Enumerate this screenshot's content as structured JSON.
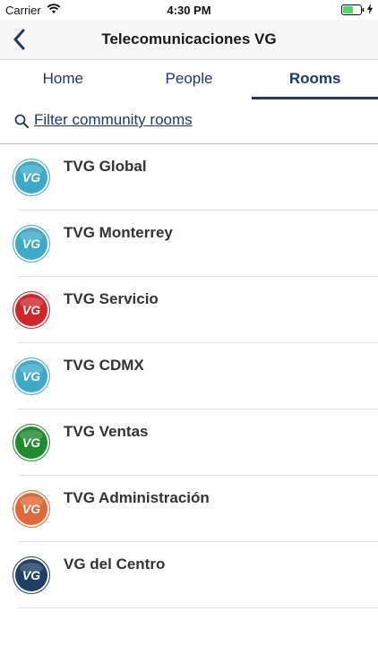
{
  "status_bar": {
    "carrier": "Carrier",
    "time": "4:30 PM"
  },
  "nav": {
    "title": "Telecomunicaciones VG",
    "back_icon": "chevron-left-icon"
  },
  "tabs": [
    {
      "label": "Home",
      "active": false
    },
    {
      "label": "People",
      "active": false
    },
    {
      "label": "Rooms",
      "active": true
    }
  ],
  "filter": {
    "label": "Filter community rooms",
    "icon": "search-icon"
  },
  "rooms": [
    {
      "name": "TVG Global",
      "avatar_text": "VG",
      "color": "#3fa9c9"
    },
    {
      "name": "TVG Monterrey",
      "avatar_text": "VG",
      "color": "#3fa9c9"
    },
    {
      "name": "TVG Servicio",
      "avatar_text": "VG",
      "color": "#d0262b"
    },
    {
      "name": "TVG CDMX",
      "avatar_text": "VG",
      "color": "#3fa9c9"
    },
    {
      "name": "TVG Ventas",
      "avatar_text": "VG",
      "color": "#1f8a2e"
    },
    {
      "name": "TVG Administración",
      "avatar_text": "VG",
      "color": "#e0683a"
    },
    {
      "name": "VG del Centro",
      "avatar_text": "VG",
      "color": "#1f3f66"
    }
  ],
  "colors": {
    "accent": "#1c3a6b",
    "battery": "#4cd964"
  }
}
